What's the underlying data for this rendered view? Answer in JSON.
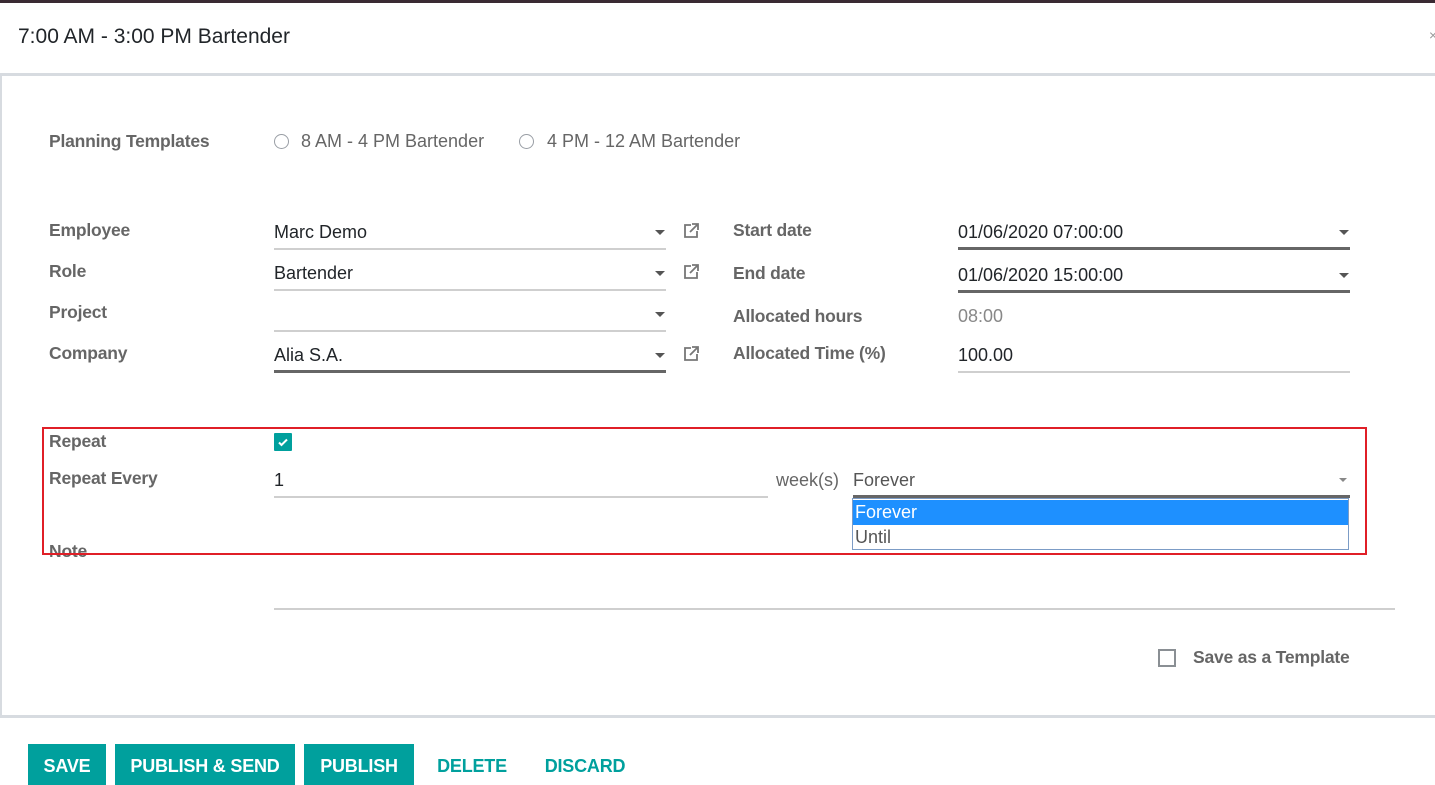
{
  "dialog": {
    "title": "7:00 AM - 3:00 PM Bartender"
  },
  "planning_templates": {
    "label": "Planning Templates",
    "options": [
      {
        "label": "8 AM - 4 PM Bartender",
        "selected": false
      },
      {
        "label": "4 PM - 12 AM Bartender",
        "selected": false
      }
    ]
  },
  "left_fields": {
    "employee": {
      "label": "Employee",
      "value": "Marc Demo"
    },
    "role": {
      "label": "Role",
      "value": "Bartender"
    },
    "project": {
      "label": "Project",
      "value": ""
    },
    "company": {
      "label": "Company",
      "value": "Alia S.A."
    }
  },
  "right_fields": {
    "start_date": {
      "label": "Start date",
      "value": "01/06/2020 07:00:00"
    },
    "end_date": {
      "label": "End date",
      "value": "01/06/2020 15:00:00"
    },
    "allocated_hours": {
      "label": "Allocated hours",
      "value": "08:00"
    },
    "allocated_time": {
      "label": "Allocated Time (%)",
      "value": "100.00"
    }
  },
  "repeat": {
    "label": "Repeat",
    "checked": true,
    "every_label": "Repeat Every",
    "every_value": "1",
    "unit": "week(s)",
    "type_value": "Forever",
    "type_options": [
      {
        "label": "Forever",
        "highlighted": true
      },
      {
        "label": "Until",
        "highlighted": false
      }
    ]
  },
  "note": {
    "label": "Note",
    "value": ""
  },
  "save_template": {
    "label": "Save as a Template",
    "checked": false
  },
  "footer": {
    "save": "SAVE",
    "publish_send": "PUBLISH & SEND",
    "publish": "PUBLISH",
    "delete": "DELETE",
    "discard": "DISCARD"
  },
  "colors": {
    "primary": "#00a09d",
    "highlight_border": "#e01f27",
    "selected_option": "#1e90ff"
  }
}
